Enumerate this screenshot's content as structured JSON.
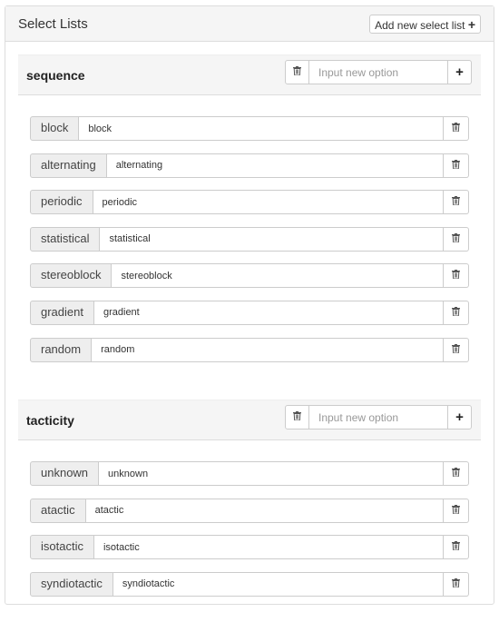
{
  "panel": {
    "title": "Select Lists",
    "add_label": "Add new select list",
    "add_icon": "+"
  },
  "icons": {
    "trash": "🗑",
    "plus": "+"
  },
  "sections": [
    {
      "title": "sequence",
      "placeholder": "Input new option",
      "items": [
        "block",
        "alternating",
        "periodic",
        "statistical",
        "stereoblock",
        "gradient",
        "random"
      ]
    },
    {
      "title": "tacticity",
      "placeholder": "Input new option",
      "items": [
        "unknown",
        "atactic",
        "isotactic",
        "syndiotactic"
      ]
    }
  ]
}
